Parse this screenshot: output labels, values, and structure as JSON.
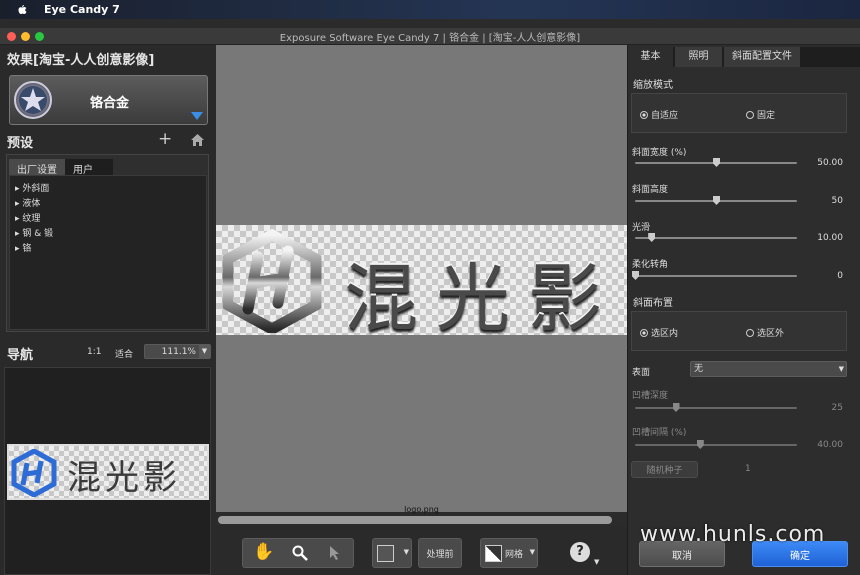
{
  "menubar": {
    "app": "Eye Candy 7"
  },
  "window": {
    "title": "Exposure Software Eye Candy 7 | 铬合金 | [淘宝-人人创意影像]"
  },
  "left": {
    "effect_title": "效果[淘宝-人人创意影像]",
    "preset_name": "铬合金",
    "presets_label": "预设",
    "add_icon": "+",
    "tabs": [
      "出厂设置",
      "用户"
    ],
    "tree": [
      "外斜面",
      "液体",
      "纹理",
      "钢 & 锻",
      "铬"
    ],
    "nav_label": "导航",
    "nav_1to1": "1:1",
    "nav_fit": "适合",
    "zoom": "111.1%",
    "thumb_text": "混光影"
  },
  "canvas": {
    "text": "混光影",
    "filename": "logo.png"
  },
  "toolbar": {
    "before_label": "处理前",
    "grid_label": "网格",
    "help": "?"
  },
  "right": {
    "tabs": [
      "基本",
      "照明",
      "斜面配置文件"
    ],
    "scale_mode_label": "缩放模式",
    "scale_options": [
      "自适应",
      "固定"
    ],
    "sliders": [
      {
        "label": "斜面宽度 (%)",
        "value": "50.00",
        "pos": 0.5
      },
      {
        "label": "斜面高度",
        "value": "50",
        "pos": 0.5
      },
      {
        "label": "光滑",
        "value": "10.00",
        "pos": 0.1
      },
      {
        "label": "柔化转角",
        "value": "0",
        "pos": 0.0
      }
    ],
    "bevel_place_label": "斜面布置",
    "bevel_options": [
      "选区内",
      "选区外"
    ],
    "surface_label": "表面",
    "surface_value": "无",
    "groove_depth": {
      "label": "凹槽深度",
      "value": "25",
      "pos": 0.25
    },
    "groove_spacing": {
      "label": "凹槽间隔 (%)",
      "value": "40.00",
      "pos": 0.4
    },
    "random_seed_label": "随机种子",
    "random_seed_value": "1",
    "cancel": "取消",
    "ok": "确定"
  },
  "watermark": "www.hunls.com"
}
